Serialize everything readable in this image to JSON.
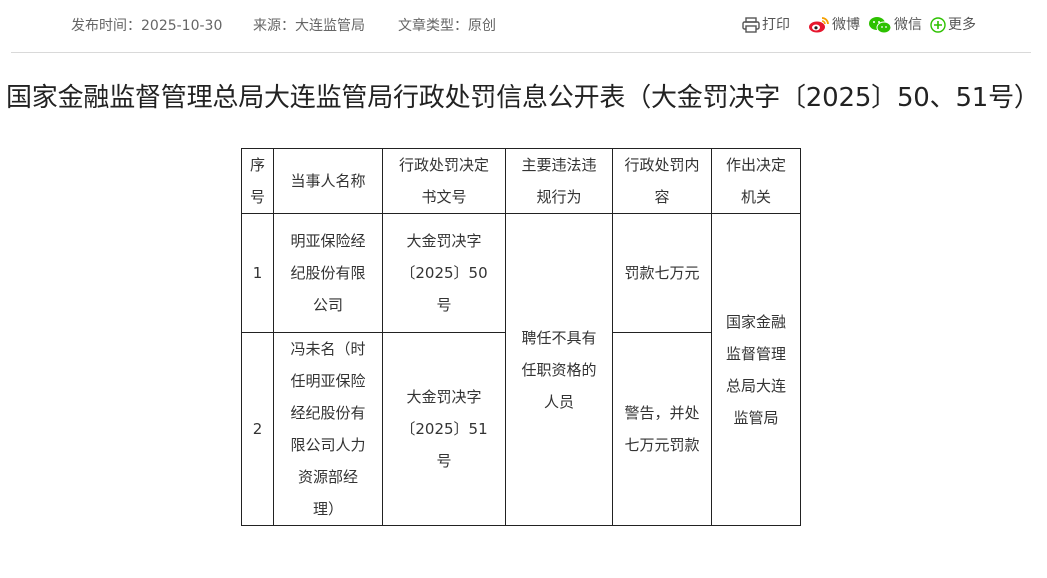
{
  "meta": {
    "publish_label": "发布时间：",
    "publish_date": "2025-10-30",
    "source_label": "来源：",
    "source_value": "大连监管局",
    "type_label": "文章类型：",
    "type_value": "原创"
  },
  "share": {
    "print_label": "打印",
    "weibo_label": "微博",
    "wechat_label": "微信",
    "more_label": "更多"
  },
  "title": "国家金融监督管理总局大连监管局行政处罚信息公开表（大金罚决字〔2025〕50、51号）",
  "table": {
    "headers": [
      "序号",
      "当事人名称",
      "行政处罚决定书文号",
      "主要违法违规行为",
      "行政处罚内容",
      "作出决定机关"
    ],
    "rows": [
      {
        "seq": "1",
        "party": "明亚保险经纪股份有限公司",
        "doc_no": "大金罚决字〔2025〕50号",
        "penalty": "罚款七万元"
      },
      {
        "seq": "2",
        "party": "冯未名（时任明亚保险经纪股份有限公司人力资源部经理）",
        "doc_no": "大金罚决字〔2025〕51号",
        "penalty": "警告，并处七万元罚款"
      }
    ],
    "violation": "聘任不具有任职资格的人员",
    "authority": "国家金融监督管理总局大连监管局"
  }
}
